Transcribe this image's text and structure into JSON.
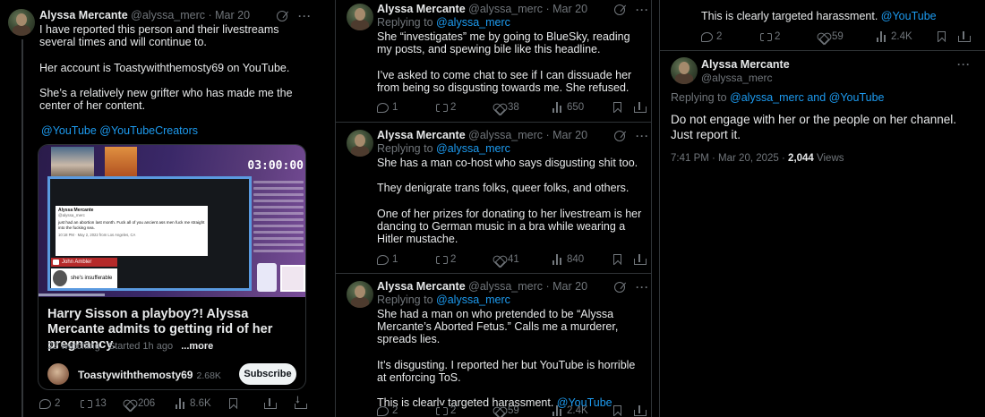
{
  "author": {
    "name": "Alyssa Mercante",
    "handle": "@alyssa_merc"
  },
  "tweets": [
    {
      "date": "Mar 20",
      "paragraphs": [
        "I have reported this person and their livestreams several times and will continue to.",
        "Her account is Toastywiththemosty69 on YouTube.",
        "She’s a relatively new grifter who has made me the center of her content."
      ],
      "mentions": "@YouTube @YouTubeCreators",
      "card": {
        "timer": "03:00:00",
        "inner_name": "Alyssa Mercante",
        "inner_handle": "@alyssa_merc",
        "inner_text": "just had an abortion last month. Fuck all of you ancient ass men fuck me straight into the fucking sea.",
        "inner_time": "10:18 PM · May 2, 2022 from Los Angeles, CA",
        "yt_name": "John Ambler",
        "caption": "she's insufferable",
        "title": "Harry Sisson a playboy?! Alyssa Mercante admits to getting rid of her pregnancy.",
        "watching": "22 watching",
        "started": "Started 1h ago",
        "more": "...more",
        "channel": "Toastywiththemosty69",
        "subs": "2.68K",
        "subscribe": "Subscribe"
      },
      "stats": {
        "replies": "2",
        "reposts": "13",
        "likes": "206",
        "views": "8.6K"
      }
    },
    {
      "date": "Mar 20",
      "replying_label": "Replying to",
      "replying_to": "@alyssa_merc",
      "paragraphs": [
        "She “investigates” me by going to BlueSky, reading my posts, and spewing bile like this headline.",
        "I’ve asked to come chat to see if I can dissuade her from being so disgusting towards me. She refused."
      ],
      "stats": {
        "replies": "1",
        "reposts": "2",
        "likes": "38",
        "views": "650"
      }
    },
    {
      "date": "Mar 20",
      "replying_label": "Replying to",
      "replying_to": "@alyssa_merc",
      "paragraphs": [
        "She has a man co-host who says disgusting shit too.",
        "They denigrate trans folks, queer folks, and others.",
        "One of her prizes for donating to her livestream is her dancing to German music in a bra while wearing a Hitler mustache."
      ],
      "stats": {
        "replies": "1",
        "reposts": "2",
        "likes": "41",
        "views": "840"
      }
    },
    {
      "date": "Mar 20",
      "replying_label": "Replying to",
      "replying_to": "@alyssa_merc",
      "paragraphs": [
        "She had a man on who pretended to be “Alyssa Mercante’s Aborted Fetus.” Calls me a murderer, spreads lies.",
        "It’s disgusting. I reported her but YouTube is horrible at enforcing ToS."
      ],
      "last_line": "This is clearly targeted harassment.",
      "last_mention": "@YouTube",
      "stats": {
        "replies": "2",
        "reposts": "2",
        "likes": "59",
        "views": "2.4K"
      }
    },
    {
      "replying_label": "Replying to",
      "replying_to": "@alyssa_merc and @YouTube",
      "text": "Do not engage with her or the people on her channel. Just report it.",
      "time": "7:41 PM · Mar 20, 2025 ·",
      "views_count": "2,044",
      "views_label": "Views"
    }
  ],
  "colors": {
    "background": "#000000",
    "text": "#e7e9ea",
    "muted": "#71767b",
    "link": "#1d9bf0",
    "border": "#2f3336"
  },
  "icons": [
    "grok-icon",
    "more-icon",
    "reply-icon",
    "repost-icon",
    "like-icon",
    "views-icon",
    "bookmark-icon",
    "share-icon",
    "download-icon"
  ]
}
